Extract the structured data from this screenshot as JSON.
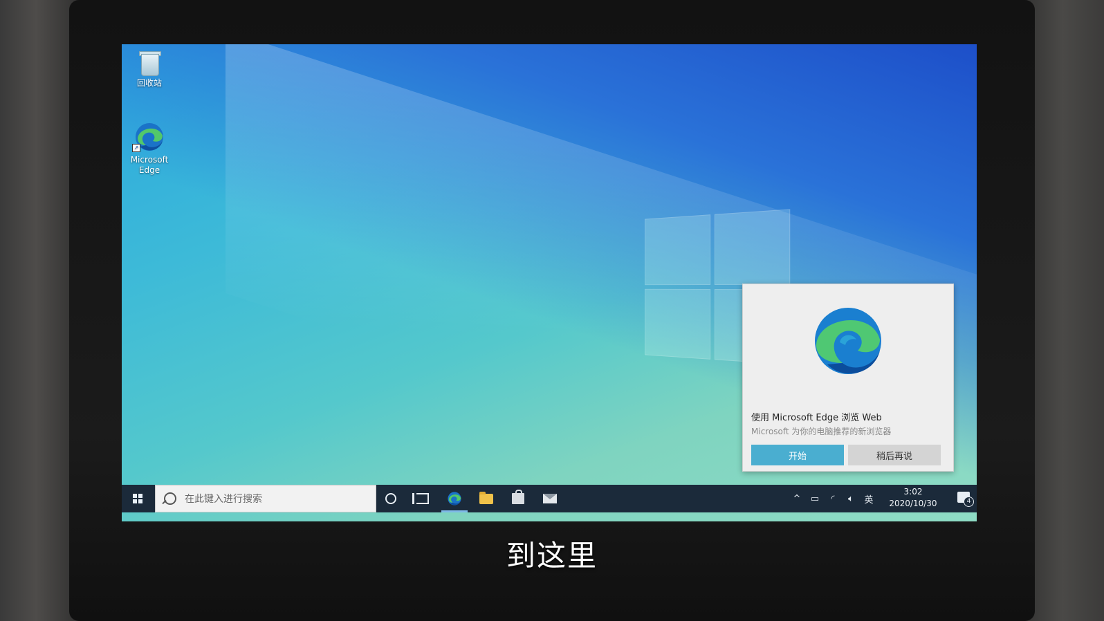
{
  "desktop": {
    "icons": [
      {
        "label": "回收站",
        "icon": "recycle-bin-icon"
      },
      {
        "label": "Microsoft Edge",
        "icon": "edge-icon"
      }
    ]
  },
  "taskbar": {
    "search_placeholder": "在此键入进行搜索",
    "pinned": [
      "cortana-icon",
      "task-view-icon",
      "edge-icon",
      "file-explorer-icon",
      "store-icon",
      "mail-icon"
    ],
    "tray": {
      "chevron": "^",
      "input_method": "英",
      "time": "3:02",
      "date": "2020/10/30",
      "notification_count": "4"
    }
  },
  "toast": {
    "title": "使用 Microsoft Edge 浏览 Web",
    "subtitle": "Microsoft 为你的电脑推荐的新浏览器",
    "primary_button": "开始",
    "secondary_button": "稍后再说"
  },
  "caption": "到这里",
  "colors": {
    "taskbar": "#1b2a3a",
    "toast_primary": "#4aaed0",
    "toast_secondary": "#d4d4d4"
  }
}
